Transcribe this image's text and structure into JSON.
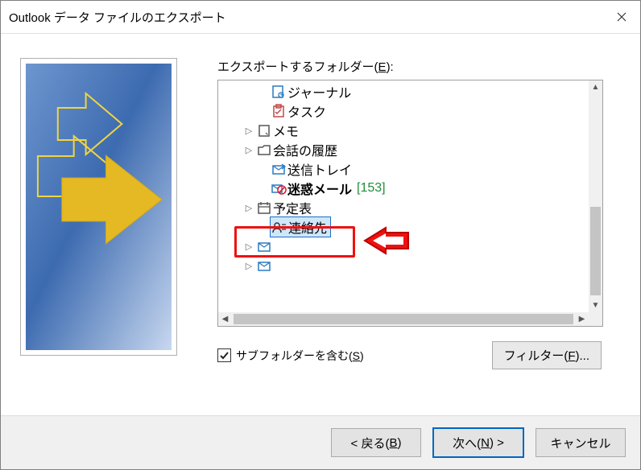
{
  "window": {
    "title": "Outlook データ ファイルのエクスポート"
  },
  "section": {
    "folder_label_pre": "エクスポートするフォルダー(",
    "folder_label_u": "E",
    "folder_label_post": "):"
  },
  "tree": {
    "items": [
      {
        "icon": "journal-icon",
        "label": "ジャーナル",
        "expandable": false,
        "bold": false,
        "count": null,
        "selected": false,
        "indent": 0
      },
      {
        "icon": "task-icon",
        "label": "タスク",
        "expandable": false,
        "bold": false,
        "count": null,
        "selected": false,
        "indent": 0
      },
      {
        "icon": "note-icon",
        "label": "メモ",
        "expandable": true,
        "bold": false,
        "count": null,
        "selected": false,
        "indent": 0
      },
      {
        "icon": "folder-icon",
        "label": "会話の履歴",
        "expandable": true,
        "bold": false,
        "count": null,
        "selected": false,
        "indent": 0
      },
      {
        "icon": "outbox-icon",
        "label": "送信トレイ",
        "expandable": false,
        "bold": false,
        "count": null,
        "selected": false,
        "indent": 0
      },
      {
        "icon": "junk-icon",
        "label": "迷惑メール",
        "expandable": false,
        "bold": true,
        "count": "[153]",
        "selected": false,
        "indent": 0
      },
      {
        "icon": "calendar-icon",
        "label": "予定表",
        "expandable": true,
        "bold": false,
        "count": null,
        "selected": false,
        "indent": 0
      },
      {
        "icon": "contacts-icon",
        "label": "連絡先",
        "expandable": false,
        "bold": false,
        "count": null,
        "selected": true,
        "indent": 0
      },
      {
        "icon": "mail-icon",
        "label": "",
        "expandable": true,
        "bold": false,
        "count": null,
        "selected": false,
        "indent": 1
      },
      {
        "icon": "mail-icon",
        "label": "",
        "expandable": true,
        "bold": false,
        "count": null,
        "selected": false,
        "indent": 1
      }
    ]
  },
  "subfolders": {
    "checked": true,
    "label_pre": "サブフォルダーを含む(",
    "label_u": "S",
    "label_post": ")"
  },
  "filter_btn": {
    "label_pre": "フィルター(",
    "label_u": "F",
    "label_post": ")..."
  },
  "buttons": {
    "back": {
      "pre": "< 戻る(",
      "u": "B",
      "post": ")"
    },
    "next": {
      "pre": "次へ(",
      "u": "N",
      "post": ") >"
    },
    "cancel": "キャンセル"
  }
}
